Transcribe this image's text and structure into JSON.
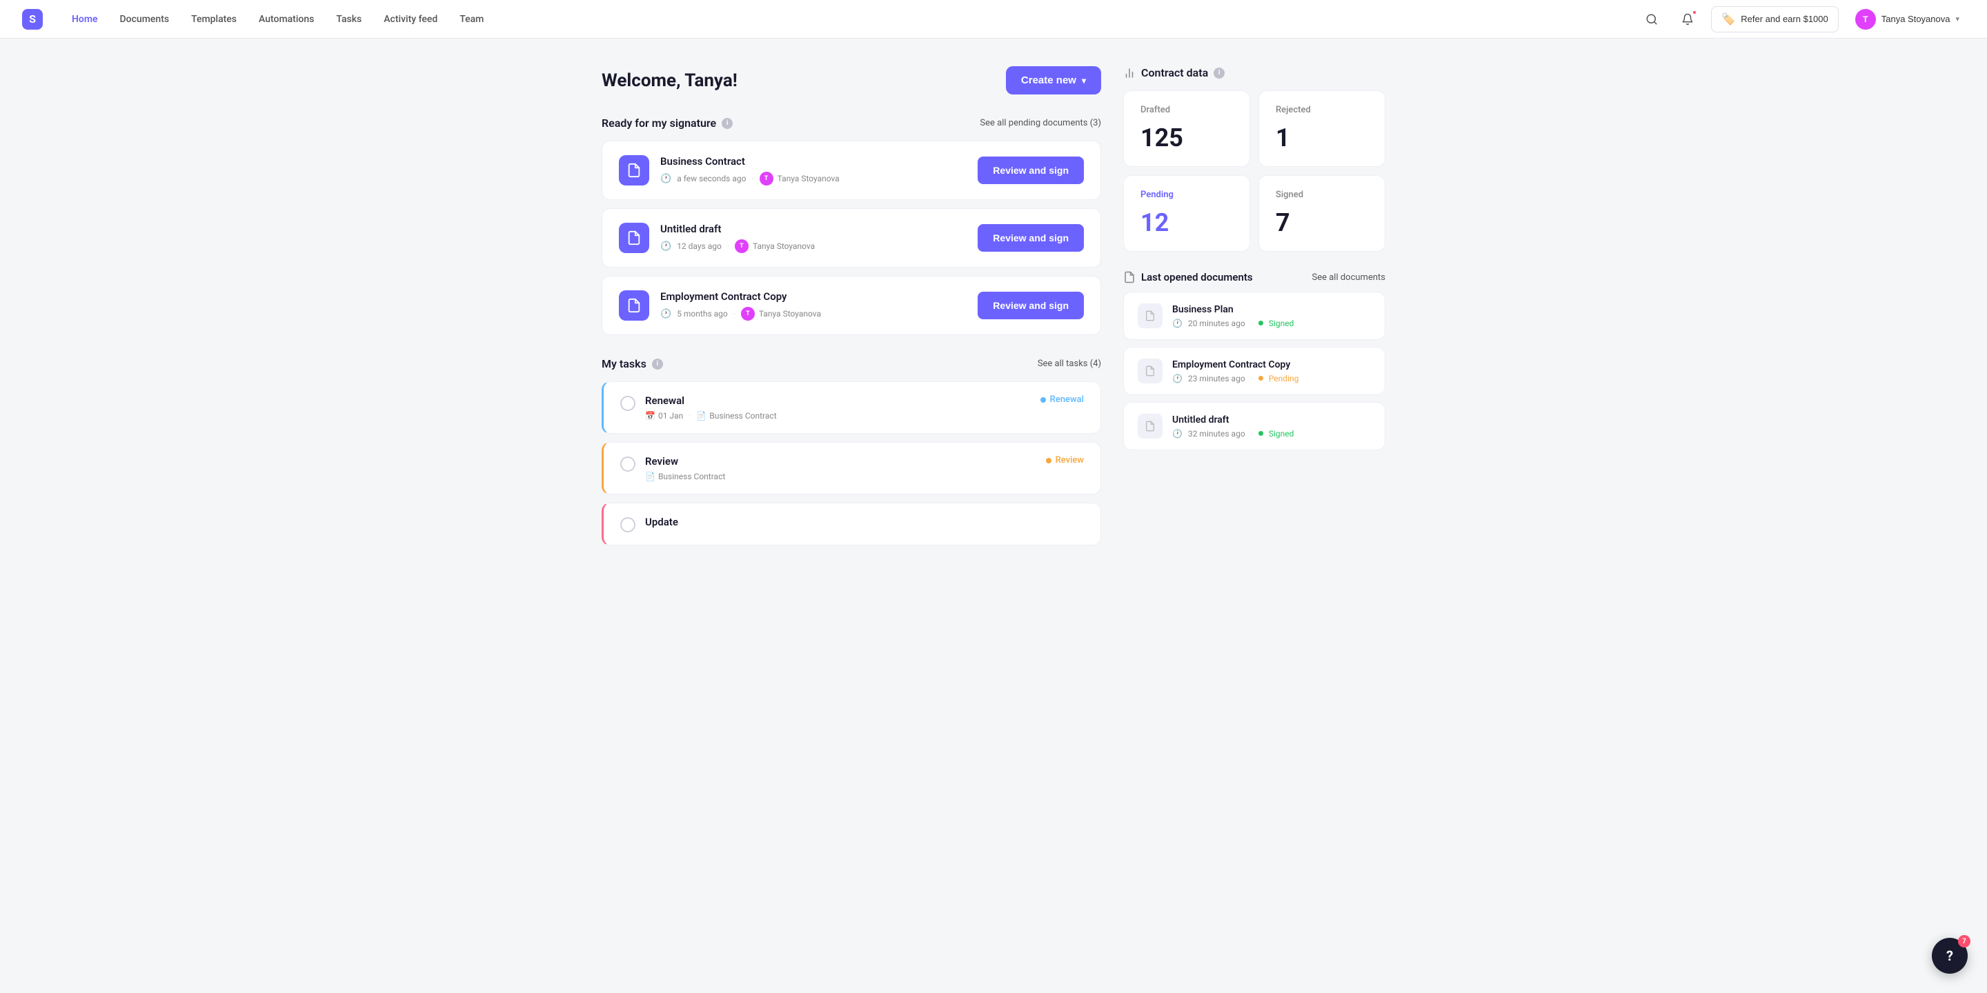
{
  "nav": {
    "logo_text": "S",
    "links": [
      {
        "label": "Home",
        "active": true
      },
      {
        "label": "Documents",
        "active": false
      },
      {
        "label": "Templates",
        "active": false
      },
      {
        "label": "Automations",
        "active": false
      },
      {
        "label": "Tasks",
        "active": false
      },
      {
        "label": "Activity feed",
        "active": false
      },
      {
        "label": "Team",
        "active": false
      }
    ],
    "refer_label": "Refer and earn $1000",
    "user_name": "Tanya Stoyanova"
  },
  "page": {
    "welcome": "Welcome, Tanya!",
    "create_btn": "Create new"
  },
  "ready_section": {
    "title": "Ready for my signature",
    "see_all": "See all pending documents (3)",
    "documents": [
      {
        "name": "Business Contract",
        "time": "a few seconds ago",
        "owner": "Tanya Stoyanova",
        "btn": "Review and sign"
      },
      {
        "name": "Untitled draft",
        "time": "12 days ago",
        "owner": "Tanya Stoyanova",
        "btn": "Review and sign"
      },
      {
        "name": "Employment Contract Copy",
        "time": "5 months ago",
        "owner": "Tanya Stoyanova",
        "btn": "Review and sign"
      }
    ]
  },
  "tasks_section": {
    "title": "My tasks",
    "see_all": "See all tasks (4)",
    "tasks": [
      {
        "name": "Renewal",
        "date": "01 Jan",
        "doc": "Business Contract",
        "badge": "Renewal",
        "type": "renewal"
      },
      {
        "name": "Review",
        "date": "",
        "doc": "Business Contract",
        "badge": "Review",
        "type": "review"
      },
      {
        "name": "Update",
        "date": "",
        "doc": "",
        "badge": "",
        "type": "update"
      }
    ]
  },
  "contract_data": {
    "title": "Contract data",
    "stats": [
      {
        "label": "Drafted",
        "value": "125",
        "type": "normal"
      },
      {
        "label": "Rejected",
        "value": "1",
        "type": "normal"
      },
      {
        "label": "Pending",
        "value": "12",
        "type": "pending"
      },
      {
        "label": "Signed",
        "value": "7",
        "type": "normal"
      }
    ]
  },
  "last_opened": {
    "title": "Last opened documents",
    "see_all": "See all documents",
    "documents": [
      {
        "name": "Business Plan",
        "time": "20 minutes ago",
        "status": "Signed",
        "status_type": "signed"
      },
      {
        "name": "Employment Contract Copy",
        "time": "23 minutes ago",
        "status": "Pending",
        "status_type": "pending"
      },
      {
        "name": "Untitled draft",
        "time": "32 minutes ago",
        "status": "Signed",
        "status_type": "signed"
      }
    ]
  },
  "help": {
    "badge": "7",
    "icon": "?"
  }
}
